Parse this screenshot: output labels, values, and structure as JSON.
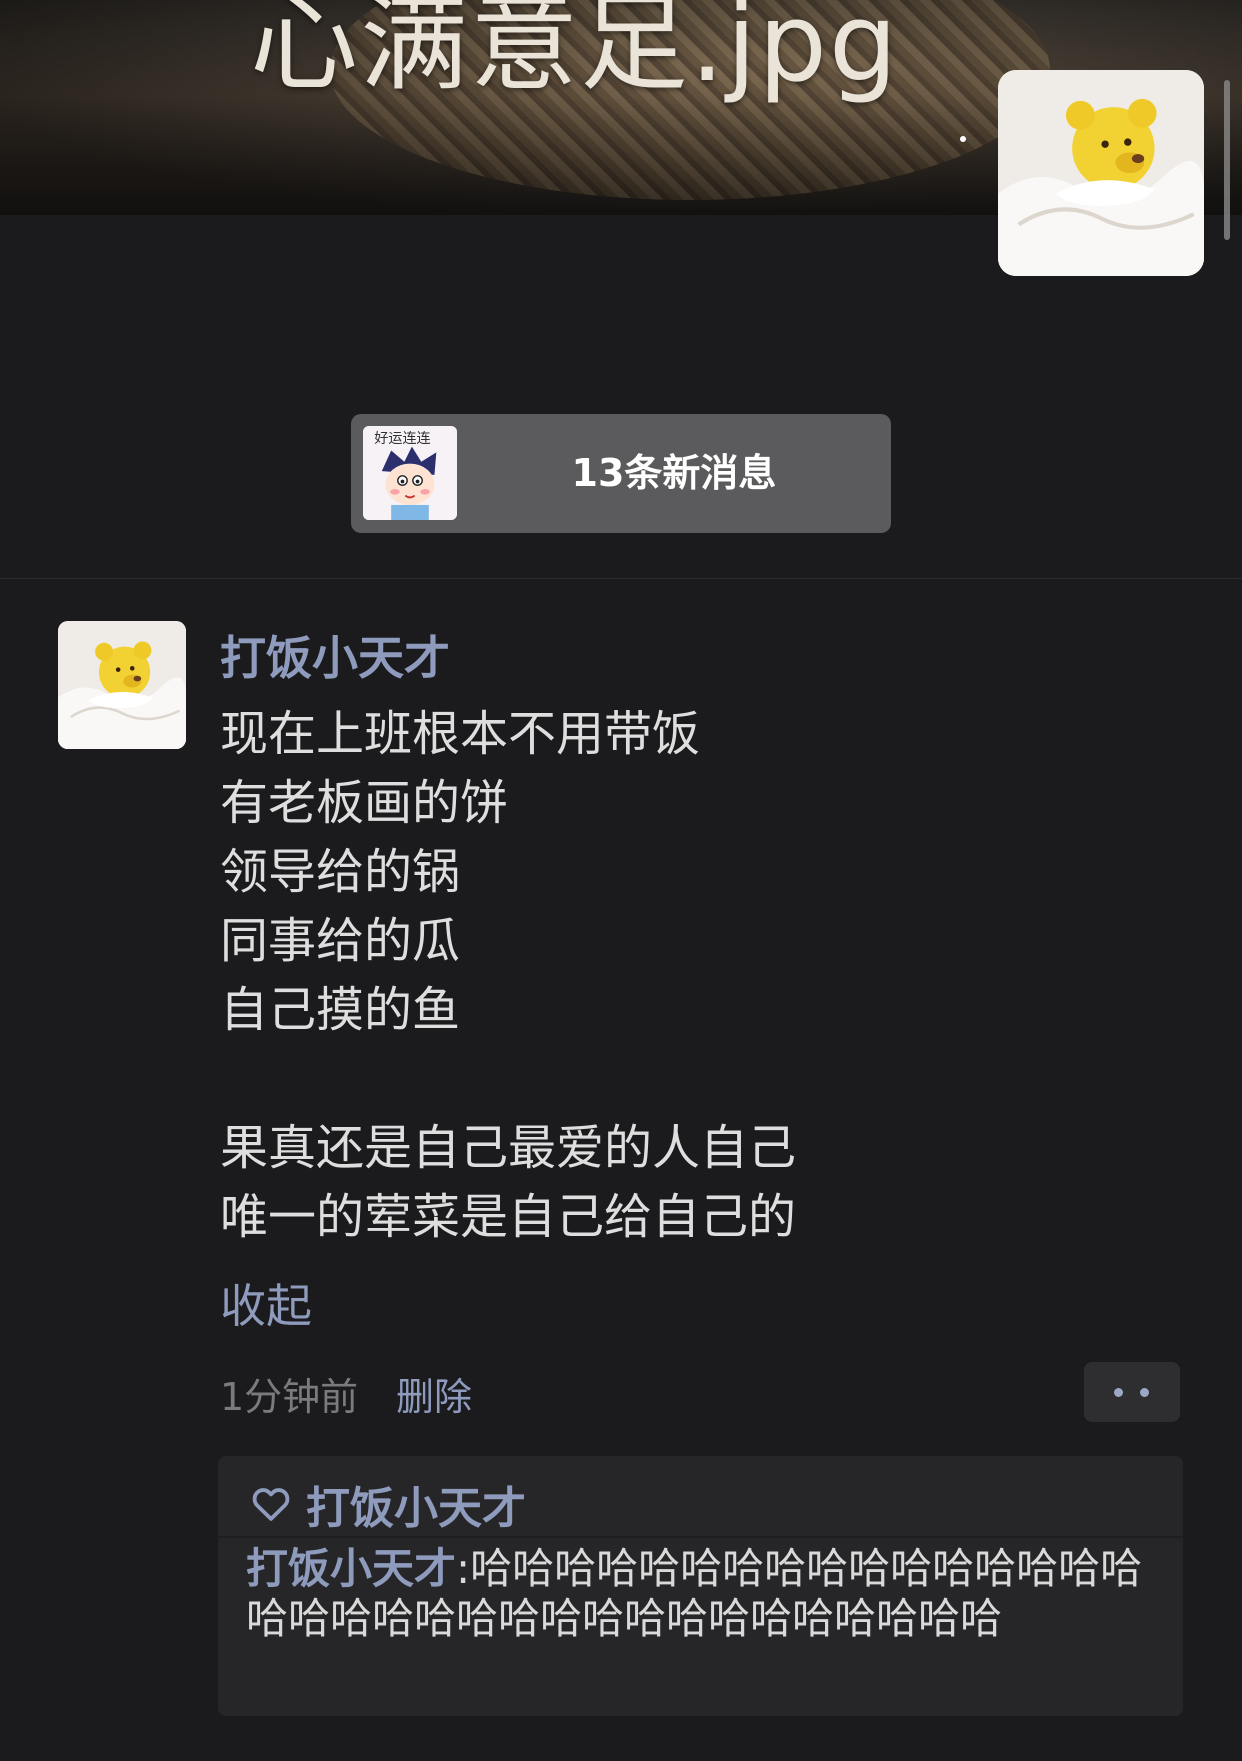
{
  "cover": {
    "caption": "心满意足.jpg"
  },
  "new_messages": {
    "thumb_text": "好运连连",
    "label": "13条新消息"
  },
  "post": {
    "author": "打饭小天才",
    "lines": [
      "现在上班根本不用带饭",
      "有老板画的饼",
      "领导给的锅",
      "同事给的瓜",
      "自己摸的鱼",
      "",
      "果真还是自己最爱的人自己",
      "唯一的荤菜是自己给自己的"
    ],
    "collapse_label": "收起",
    "time": "1分钟前",
    "delete_label": "删除"
  },
  "interactions": {
    "likes": "打饭小天才",
    "comment_author": "打饭小天才",
    "comment_separator": ":",
    "comment_text": "哈哈哈哈哈哈哈哈哈哈哈哈哈哈哈哈哈哈哈哈哈哈哈哈哈哈哈哈哈哈哈哈哈哈"
  },
  "colors": {
    "background": "#1b1b1d",
    "link": "#8e9bbd",
    "text": "#dedede",
    "muted": "#7b7b7d"
  }
}
